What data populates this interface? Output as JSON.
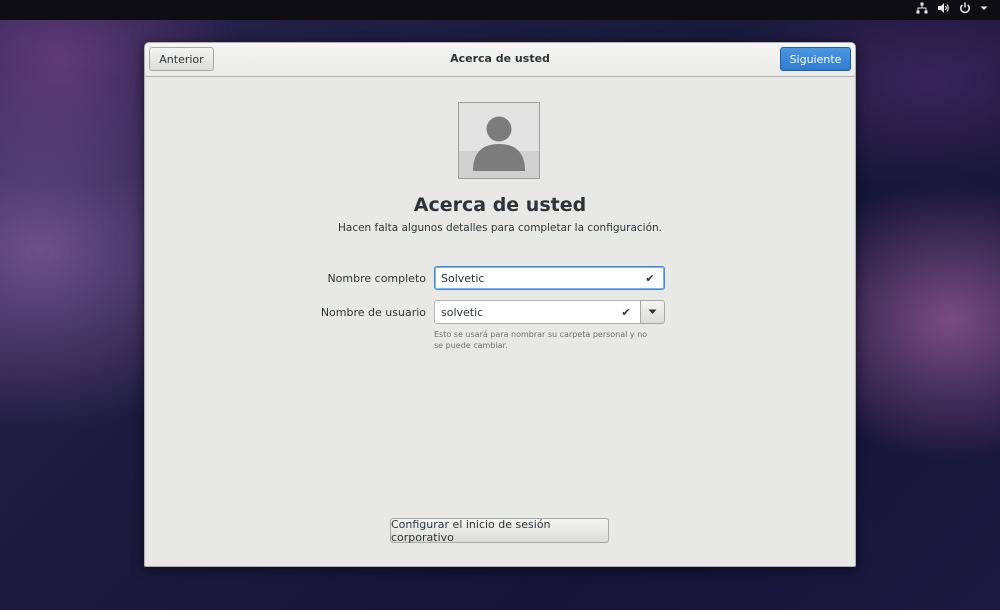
{
  "topbar": {
    "icons": [
      "network-icon",
      "volume-icon",
      "power-icon",
      "chevron-down-icon"
    ]
  },
  "header": {
    "back_label": "Anterior",
    "title": "Acerca de usted",
    "next_label": "Siguiente"
  },
  "main": {
    "heading": "Acerca de usted",
    "subtitle": "Hacen falta algunos detalles para completar la configuración.",
    "fullname": {
      "label": "Nombre completo",
      "value": "Solvetic"
    },
    "username": {
      "label": "Nombre de usuario",
      "value": "solvetic"
    },
    "hint": "Esto se usará para nombrar su carpeta personal y no se puede cambiar.",
    "enterprise_label": "Configurar el inicio de sesión corporativo"
  },
  "colors": {
    "accent": "#3584e4",
    "window_bg": "#e8e8e7",
    "topbar_bg": "#0e0e12"
  }
}
